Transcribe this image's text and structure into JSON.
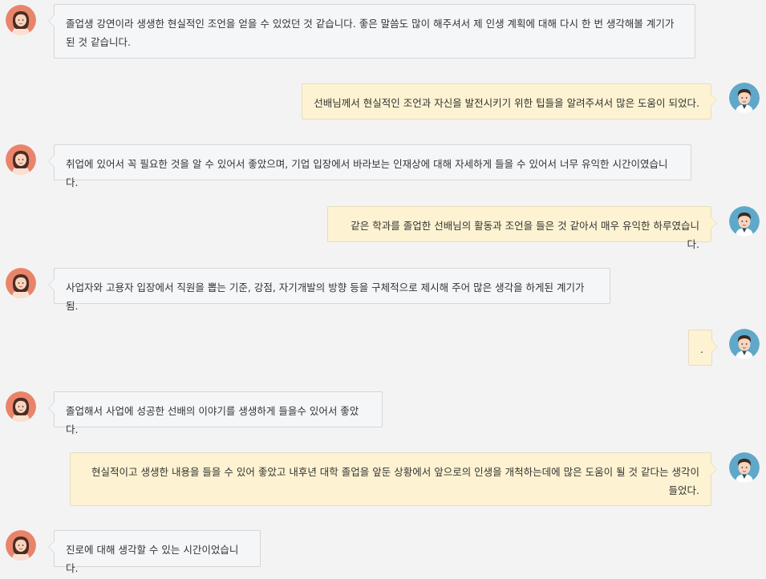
{
  "messages": [
    {
      "side": "left",
      "avatar": "female-avatar-icon",
      "text": "졸업생 강연이라 생생한 현실적인 조언을 얻을 수 있었던 것 같습니다. 좋은 말씀도 많이 해주셔서 제 인생 계획에 대해 다시 한 번 생각해볼 계기가 된 것 같습니다."
    },
    {
      "side": "right",
      "avatar": "male-avatar-icon",
      "text": "선배님께서 현실적인 조언과 자신을 발전시키기 위한 팁들을 알려주셔서 많은 도움이 되었다."
    },
    {
      "side": "left",
      "avatar": "female-avatar-icon",
      "text": "취업에 있어서 꼭 필요한 것을 알 수 있어서 좋았으며, 기업 입장에서 바라보는 인재상에 대해 자세하게 들을 수 있어서 너무 유익한 시간이였습니다."
    },
    {
      "side": "right",
      "avatar": "male-avatar-icon",
      "text": "같은 학과를 졸업한 선배님의 활동과 조언을 들은 것 같아서 매우 유익한 하루였습니다."
    },
    {
      "side": "left",
      "avatar": "female-avatar-icon",
      "text": "사업자와 고용자 입장에서 직원을 뽑는 기준, 강점, 자기개발의 방향 등을 구체적으로 제시해 주어 많은 생각을 하게된 계기가 됨."
    },
    {
      "side": "right",
      "avatar": "male-avatar-icon",
      "text": "."
    },
    {
      "side": "left",
      "avatar": "female-avatar-icon",
      "text": "졸업해서 사업에 성공한 선배의 이야기를 생생하게 들을수 있어서 좋았다."
    },
    {
      "side": "right",
      "avatar": "male-avatar-icon",
      "text": "현실적이고 생생한 내용을 들을 수 있어 좋았고 내후년 대학 졸업을 앞둔 상황에서 앞으로의 인생을 개척하는데에 많은 도움이 될 것 같다는 생각이 들었다."
    },
    {
      "side": "left",
      "avatar": "female-avatar-icon",
      "text": "진로에 대해 생각할 수 있는 시간이었습니다."
    }
  ],
  "colors": {
    "background": "#f3f3f3",
    "left_bubble": "#f5f6f7",
    "right_bubble": "#fdf3d2",
    "female_avatar_bg": "#e9846b",
    "male_avatar_bg": "#5fa8c9"
  }
}
